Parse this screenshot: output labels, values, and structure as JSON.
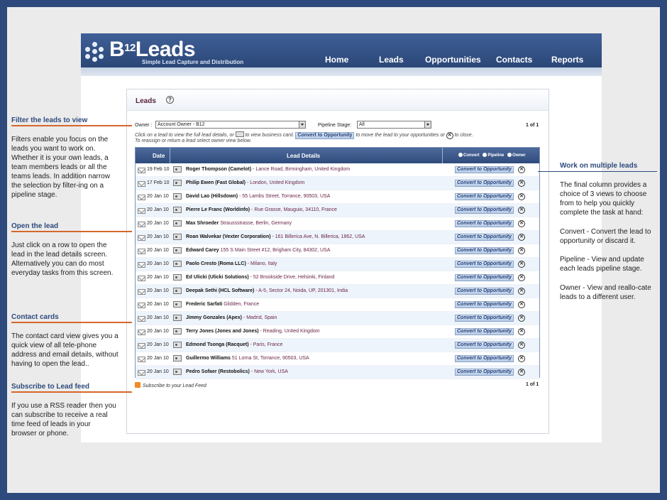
{
  "logo": {
    "brand": "B",
    "sup": "12",
    "name": "Leads",
    "tagline": "Simple Lead Capture and Distribution"
  },
  "nav": [
    "Home",
    "Leads",
    "Opportunities",
    "Contacts",
    "Reports"
  ],
  "panel": {
    "title": "Leads",
    "help_glyph": "?",
    "owner_label": "Owner :",
    "owner_value": "Account Owner - B12",
    "stage_label": "Pipeline Stage:",
    "stage_value": "All",
    "page_top": "1 of 1",
    "hint1a": "Click on a lead to view the full lead details, or",
    "hint1b": "to view business card.",
    "convert_label": "Convert to Opportunity",
    "hint1c": "to move the lead to your opportunities or",
    "hint1d": "to close.",
    "hint2": "To reassign or return a lead select owner view below.",
    "col_date": "Date",
    "col_details": "Lead Details",
    "views": [
      "Convert",
      "Pipeline",
      "Owner"
    ],
    "close_glyph": "✕",
    "feed": "Subscribe to your Lead Feed",
    "page_bottom": "1 of 1"
  },
  "rows": [
    {
      "date": "19 Feb 10",
      "name": "Roger Thompson (Camelot)",
      "addr": " - Lance Road, Birmingham, United Kingdom"
    },
    {
      "date": "17 Feb 10",
      "name": "Philip Ewen (Fast Global)",
      "addr": " - London, United Kingdom"
    },
    {
      "date": "20 Jan 10",
      "name": "David Lao (Hillsdown)",
      "addr": " - 55 Lambs Street, Torrance, 90503, USA"
    },
    {
      "date": "20 Jan 10",
      "name": "Pierre Le Franc (Worldinfo)",
      "addr": " - Rue Grasse, Mauguio, 34110, France"
    },
    {
      "date": "20 Jan 10",
      "name": "Max Shroeder",
      "addr": " Straussstrasse, Berlin, Germany"
    },
    {
      "date": "20 Jan 10",
      "name": "Roan Walvekar (Vexter Corporation)",
      "addr": " - 161 Billerica Ave, N. Billerica, 1862, USA"
    },
    {
      "date": "20 Jan 10",
      "name": "Edward Carey",
      "addr": " 155 S Main Street #12, Brigham City, 84302, USA"
    },
    {
      "date": "20 Jan 10",
      "name": "Paolo Cresto (Roma LLC)",
      "addr": " - Milano, Italy"
    },
    {
      "date": "20 Jan 10",
      "name": "Ed Ulicki (Ulicki Solutions)",
      "addr": " - 52 Brookside Drive, Helsinki, Finland"
    },
    {
      "date": "20 Jan 10",
      "name": "Deepak Sethi (HCL Software)",
      "addr": " - A-5, Sector 24, Noida, UP, 201301, India"
    },
    {
      "date": "20 Jan 10",
      "name": "Frederic Sarfati",
      "addr": " Glidden, France"
    },
    {
      "date": "20 Jan 10",
      "name": "Jimmy Gonzales (Apex)",
      "addr": " - Madrid, Spain"
    },
    {
      "date": "20 Jan 10",
      "name": "Terry Jones (Jones and Jones)",
      "addr": " - Reading, United Kingdom"
    },
    {
      "date": "20 Jan 10",
      "name": "Edmond Tsonga (Racquet)",
      "addr": " - Paris, France"
    },
    {
      "date": "20 Jan 10",
      "name": "Guillermo Williams",
      "addr": " 51 Lorna St, Torrance, 90503, USA"
    },
    {
      "date": "20 Jan 10",
      "name": "Pedro Sofaer (Restobolics)",
      "addr": " - New York, USA"
    }
  ],
  "left": [
    {
      "title": "Filter the leads to view",
      "text": "Filters enable you focus on the leads you want to work on. Whether it is your own leads, a team members leads or all the teams leads. In addition narrow the selection by filter-ing on a pipeline stage."
    },
    {
      "title": "Open the lead",
      "text": "Just click on a row to open the lead in the lead details screen. Alternatively you can do most everyday tasks from this screen."
    },
    {
      "title": "Contact cards",
      "text": "The contact card view gives you a quick view of all tele-phone  address and email details, without having to open the lead.."
    },
    {
      "title": "Subscribe to Lead feed",
      "text": "If you use a RSS reader then you can subscribe to receive a real time feed of leads in your browser or phone."
    }
  ],
  "right": {
    "title": "Work on multiple leads",
    "paras": [
      "The final column provides a choice of 3 views to choose from to help you quickly complete the task at hand:",
      "Convert - Convert the lead to opportunity or discard it.",
      "Pipeline - View and update each leads pipeline stage.",
      "Owner - View and reallo-cate leads to a different user."
    ]
  }
}
